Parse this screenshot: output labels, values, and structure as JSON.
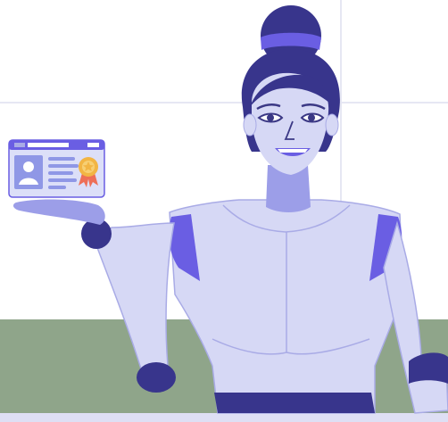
{
  "illustration": {
    "subject": "robot-presenting-id-card",
    "colors": {
      "wall": "#ffffff",
      "wall_lines": "#e6e7f3",
      "floor": "#8fa58a",
      "floor_edge": "#dedff4",
      "robot_body": "#d6d8f5",
      "robot_shade": "#9c9ee8",
      "robot_outline": "#a9abe6",
      "accent_purple": "#6a5ee3",
      "dark_navy": "#38358c",
      "face_features": "#3b3885",
      "id_card_bg": "#dcdff8",
      "id_card_header": "#6a5ee3",
      "id_photo_bg": "#8f97e6",
      "medal_gold": "#f2b544",
      "ribbon_red": "#ee6f57"
    },
    "icons": [
      "id-card-icon",
      "user-avatar-icon",
      "award-medal-icon"
    ]
  }
}
